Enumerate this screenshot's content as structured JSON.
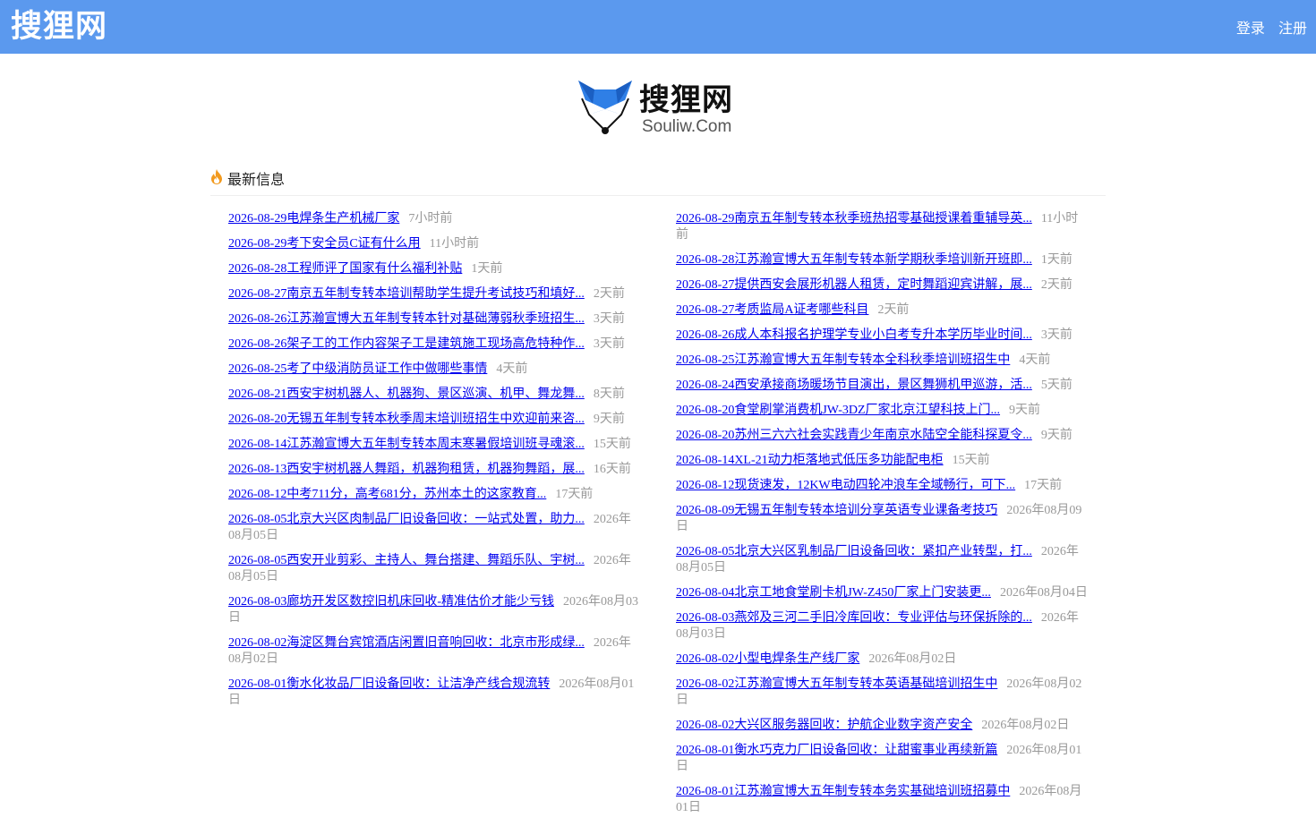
{
  "header": {
    "brand": "搜狸网",
    "login": "登录",
    "register": "注册"
  },
  "logo": {
    "name": "搜狸网",
    "domain": "Souliw.Com"
  },
  "section": {
    "title": "最新信息"
  },
  "left_items": [
    {
      "title": "2026-08-29电焊条生产机械厂家",
      "time": "7小时前"
    },
    {
      "title": "2026-08-29考下安全员C证有什么用",
      "time": "11小时前"
    },
    {
      "title": "2026-08-28工程师评了国家有什么福利补贴",
      "time": "1天前"
    },
    {
      "title": "2026-08-27南京五年制专转本培训帮助学生提升考试技巧和填好...",
      "time": "2天前"
    },
    {
      "title": "2026-08-26江苏瀚宣博大五年制专转本针对基础薄弱秋季班招生...",
      "time": "3天前"
    },
    {
      "title": "2026-08-26架子工的工作内容架子工是建筑施工现场高危特种作...",
      "time": "3天前"
    },
    {
      "title": "2026-08-25考了中级消防员证工作中做哪些事情",
      "time": "4天前"
    },
    {
      "title": "2026-08-21西安宇树机器人、机器狗、景区巡演、机甲、舞龙舞...",
      "time": "8天前"
    },
    {
      "title": "2026-08-20无锡五年制专转本秋季周末培训班招生中欢迎前来咨...",
      "time": "9天前"
    },
    {
      "title": "2026-08-14江苏瀚宣博大五年制专转本周末寒暑假培训班寻魂滚...",
      "time": "15天前"
    },
    {
      "title": "2026-08-13西安宇树机器人舞蹈，机器狗租赁，机器狗舞蹈，展...",
      "time": "16天前"
    },
    {
      "title": "2026-08-12中考711分，高考681分，苏州本土的这家教育...",
      "time": "17天前"
    },
    {
      "title": "2026-08-05北京大兴区肉制品厂旧设备回收：一站式处置，助力...",
      "time": "2026年08月05日"
    },
    {
      "title": "2026-08-05西安开业剪彩、主持人、舞台搭建、舞蹈乐队、宇树...",
      "time": "2026年08月05日"
    },
    {
      "title": "2026-08-03廊坊开发区数控旧机床回收-精准估价才能少亏钱",
      "time": "2026年08月03日"
    },
    {
      "title": "2026-08-02海淀区舞台宾馆酒店闲置旧音响回收：北京市形成绿...",
      "time": "2026年08月02日"
    },
    {
      "title": "2026-08-01衡水化妆品厂旧设备回收：让洁净产线合规流转",
      "time": "2026年08月01日"
    }
  ],
  "right_items": [
    {
      "title": "2026-08-29南京五年制专转本秋季班热招零基础授课着重辅导英...",
      "time": "11小时前"
    },
    {
      "title": "2026-08-28江苏瀚宣博大五年制专转本新学期秋季培训新开班即...",
      "time": "1天前"
    },
    {
      "title": "2026-08-27提供西安会展形机器人租赁，定时舞蹈迎宾讲解，展...",
      "time": "2天前"
    },
    {
      "title": "2026-08-27考质监局A证考哪些科目",
      "time": "2天前"
    },
    {
      "title": "2026-08-26成人本科报名护理学专业小白考专升本学历毕业时间...",
      "time": "3天前"
    },
    {
      "title": "2026-08-25江苏瀚宣博大五年制专转本全科秋季培训班招生中",
      "time": "4天前"
    },
    {
      "title": "2026-08-24西安承接商场暖场节目演出，景区舞狮机甲巡游，活...",
      "time": "5天前"
    },
    {
      "title": "2026-08-20食堂刷掌消费机JW-3DZ厂家北京江望科技上门...",
      "time": "9天前"
    },
    {
      "title": "2026-08-20苏州三六六社会实践青少年南京水陆空全能科探夏令...",
      "time": "9天前"
    },
    {
      "title": "2026-08-14XL-21动力柜落地式低压多功能配电柜",
      "time": "15天前"
    },
    {
      "title": "2026-08-12现货速发，12KW电动四轮冲浪车全域畅行，可下...",
      "time": "17天前"
    },
    {
      "title": "2026-08-09无锡五年制专转本培训分享英语专业课备考技巧",
      "time": "2026年08月09日"
    },
    {
      "title": "2026-08-05北京大兴区乳制品厂旧设备回收：紧扣产业转型，打...",
      "time": "2026年08月05日"
    },
    {
      "title": "2026-08-04北京工地食堂刷卡机JW-Z450厂家上门安装更...",
      "time": "2026年08月04日"
    },
    {
      "title": "2026-08-03燕郊及三河二手旧冷库回收：专业评估与环保拆除的...",
      "time": "2026年08月03日"
    },
    {
      "title": "2026-08-02小型电焊条生产线厂家",
      "time": "2026年08月02日"
    },
    {
      "title": "2026-08-02江苏瀚宣博大五年制专转本英语基础培训招生中",
      "time": "2026年08月02日"
    },
    {
      "title": "2026-08-02大兴区服务器回收：护航企业数字资产安全",
      "time": "2026年08月02日"
    },
    {
      "title": "2026-08-01衡水巧克力厂旧设备回收：让甜蜜事业再续新篇",
      "time": "2026年08月01日"
    },
    {
      "title": "2026-08-01江苏瀚宣博大五年制专转本务实基础培训班招募中",
      "time": "2026年08月01日"
    }
  ]
}
